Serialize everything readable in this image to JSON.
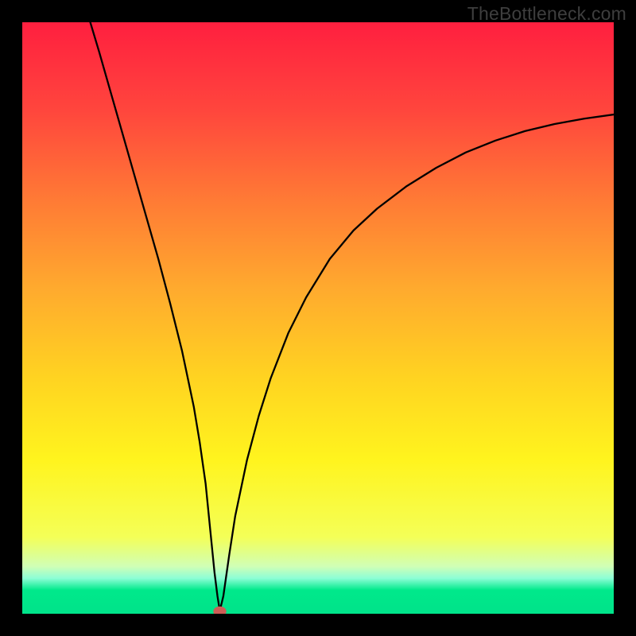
{
  "watermark": "TheBottleneck.com",
  "chart_data": {
    "type": "line",
    "title": "",
    "xlabel": "",
    "ylabel": "",
    "xlim": [
      0,
      100
    ],
    "ylim": [
      0,
      100
    ],
    "grid": false,
    "legend": false,
    "gradient_bands": [
      {
        "y": 0,
        "color": "#ff1f3f"
      },
      {
        "y": 15,
        "color": "#ff463d"
      },
      {
        "y": 30,
        "color": "#ff7a35"
      },
      {
        "y": 45,
        "color": "#ffaa2e"
      },
      {
        "y": 60,
        "color": "#ffd321"
      },
      {
        "y": 74,
        "color": "#fff41e"
      },
      {
        "y": 87,
        "color": "#f4ff57"
      },
      {
        "y": 92,
        "color": "#d0ffb6"
      },
      {
        "y": 94,
        "color": "#8dfed6"
      },
      {
        "y": 96,
        "color": "#00e98b"
      },
      {
        "y": 99,
        "color": "#00e48a"
      },
      {
        "y": 100,
        "color": "#00e48a"
      }
    ],
    "series": [
      {
        "name": "bottleneck-curve",
        "color": "#000000",
        "x": [
          11.5,
          13,
          15,
          17,
          19,
          21,
          23,
          25,
          27,
          29,
          30,
          31,
          31.8,
          32.5,
          33,
          33.4,
          34,
          35,
          36,
          38,
          40,
          42,
          45,
          48,
          52,
          56,
          60,
          65,
          70,
          75,
          80,
          85,
          90,
          95,
          100
        ],
        "values": [
          100,
          95,
          88,
          81,
          74,
          67,
          60,
          52.5,
          44.5,
          35,
          29,
          22,
          14,
          7,
          3,
          0.5,
          3,
          10,
          16.5,
          26,
          33.5,
          39.8,
          47.5,
          53.5,
          60,
          64.8,
          68.5,
          72.3,
          75.4,
          78,
          80,
          81.6,
          82.8,
          83.7,
          84.4
        ]
      }
    ],
    "marker": {
      "x": 33.4,
      "y": 0.4,
      "color": "#cd5d56",
      "rx": 1.1,
      "ry": 0.85
    }
  }
}
